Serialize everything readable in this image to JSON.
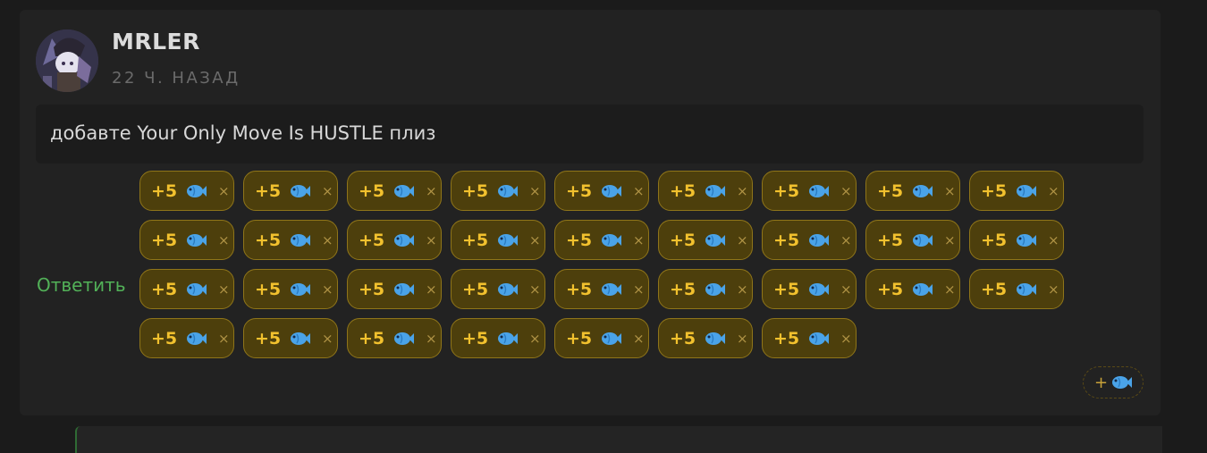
{
  "comment": {
    "author": "MRLER",
    "timestamp": "22 Ч. НАЗАД",
    "text": "добавте Your Only Move Is HUSTLE плиз",
    "reply_label": "Ответить",
    "reactions": [
      {
        "amount": "+5",
        "icon": "fish-icon",
        "remove": "×"
      },
      {
        "amount": "+5",
        "icon": "fish-icon",
        "remove": "×"
      },
      {
        "amount": "+5",
        "icon": "fish-icon",
        "remove": "×"
      },
      {
        "amount": "+5",
        "icon": "fish-icon",
        "remove": "×"
      },
      {
        "amount": "+5",
        "icon": "fish-icon",
        "remove": "×"
      },
      {
        "amount": "+5",
        "icon": "fish-icon",
        "remove": "×"
      },
      {
        "amount": "+5",
        "icon": "fish-icon",
        "remove": "×"
      },
      {
        "amount": "+5",
        "icon": "fish-icon",
        "remove": "×"
      },
      {
        "amount": "+5",
        "icon": "fish-icon",
        "remove": "×"
      },
      {
        "amount": "+5",
        "icon": "fish-icon",
        "remove": "×"
      },
      {
        "amount": "+5",
        "icon": "fish-icon",
        "remove": "×"
      },
      {
        "amount": "+5",
        "icon": "fish-icon",
        "remove": "×"
      },
      {
        "amount": "+5",
        "icon": "fish-icon",
        "remove": "×"
      },
      {
        "amount": "+5",
        "icon": "fish-icon",
        "remove": "×"
      },
      {
        "amount": "+5",
        "icon": "fish-icon",
        "remove": "×"
      },
      {
        "amount": "+5",
        "icon": "fish-icon",
        "remove": "×"
      },
      {
        "amount": "+5",
        "icon": "fish-icon",
        "remove": "×"
      },
      {
        "amount": "+5",
        "icon": "fish-icon",
        "remove": "×"
      },
      {
        "amount": "+5",
        "icon": "fish-icon",
        "remove": "×"
      },
      {
        "amount": "+5",
        "icon": "fish-icon",
        "remove": "×"
      },
      {
        "amount": "+5",
        "icon": "fish-icon",
        "remove": "×"
      },
      {
        "amount": "+5",
        "icon": "fish-icon",
        "remove": "×"
      },
      {
        "amount": "+5",
        "icon": "fish-icon",
        "remove": "×"
      },
      {
        "amount": "+5",
        "icon": "fish-icon",
        "remove": "×"
      },
      {
        "amount": "+5",
        "icon": "fish-icon",
        "remove": "×"
      },
      {
        "amount": "+5",
        "icon": "fish-icon",
        "remove": "×"
      },
      {
        "amount": "+5",
        "icon": "fish-icon",
        "remove": "×"
      },
      {
        "amount": "+5",
        "icon": "fish-icon",
        "remove": "×"
      },
      {
        "amount": "+5",
        "icon": "fish-icon",
        "remove": "×"
      },
      {
        "amount": "+5",
        "icon": "fish-icon",
        "remove": "×"
      },
      {
        "amount": "+5",
        "icon": "fish-icon",
        "remove": "×"
      },
      {
        "amount": "+5",
        "icon": "fish-icon",
        "remove": "×"
      },
      {
        "amount": "+5",
        "icon": "fish-icon",
        "remove": "×"
      },
      {
        "amount": "+5",
        "icon": "fish-icon",
        "remove": "×"
      }
    ],
    "add_reaction": {
      "plus": "+",
      "icon": "fish-icon"
    }
  },
  "colors": {
    "card_bg": "#222222",
    "reaction_bg": "#4d3f0c",
    "reaction_border": "#8f7519",
    "reaction_text": "#f2c12e",
    "reply_link": "#52b158",
    "fish": "#4aa3e8"
  }
}
